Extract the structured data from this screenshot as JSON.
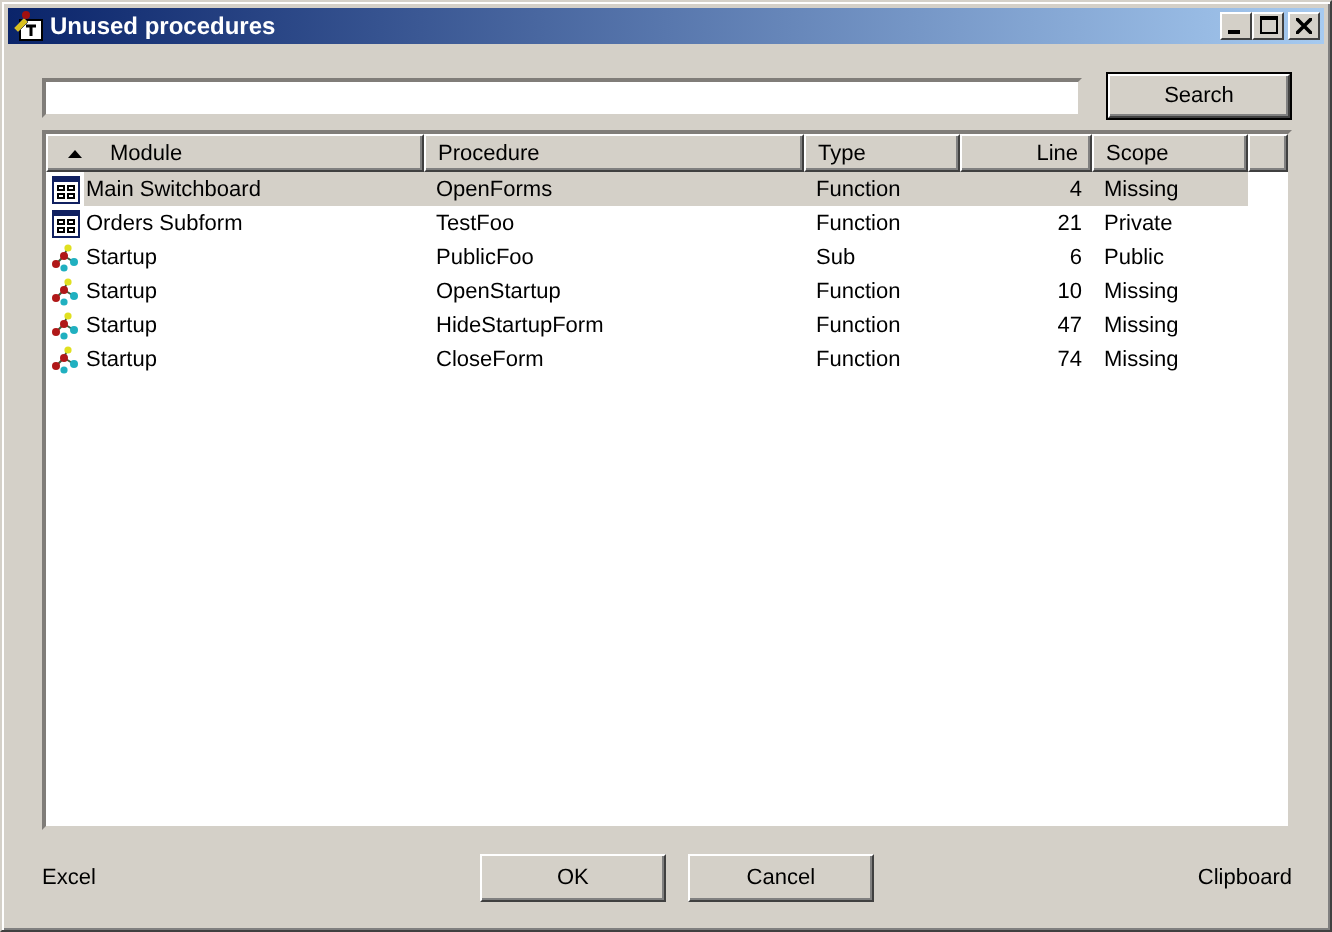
{
  "window": {
    "title": "Unused procedures"
  },
  "search": {
    "button": "Search"
  },
  "table": {
    "columns": [
      {
        "label": "Module",
        "sorted": true
      },
      {
        "label": "Procedure",
        "sorted": false
      },
      {
        "label": "Type",
        "sorted": false
      },
      {
        "label": "Line",
        "sorted": false
      },
      {
        "label": "Scope",
        "sorted": false
      }
    ],
    "rows": [
      {
        "kind": "form",
        "selected": true,
        "cells": [
          "Main Switchboard",
          "OpenForms",
          "Function",
          "4",
          "Missing"
        ]
      },
      {
        "kind": "form",
        "selected": false,
        "cells": [
          "Orders Subform",
          "TestFoo",
          "Function",
          "21",
          "Private"
        ]
      },
      {
        "kind": "module",
        "selected": false,
        "cells": [
          "Startup",
          "PublicFoo",
          "Sub",
          "6",
          "Public"
        ]
      },
      {
        "kind": "module",
        "selected": false,
        "cells": [
          "Startup",
          "OpenStartup",
          "Function",
          "10",
          "Missing"
        ]
      },
      {
        "kind": "module",
        "selected": false,
        "cells": [
          "Startup",
          "HideStartupForm",
          "Function",
          "47",
          "Missing"
        ]
      },
      {
        "kind": "module",
        "selected": false,
        "cells": [
          "Startup",
          "CloseForm",
          "Function",
          "74",
          "Missing"
        ]
      }
    ]
  },
  "footer": {
    "left_link": "Excel",
    "buttons": [
      "OK",
      "Cancel"
    ],
    "right_link": "Clipboard"
  }
}
